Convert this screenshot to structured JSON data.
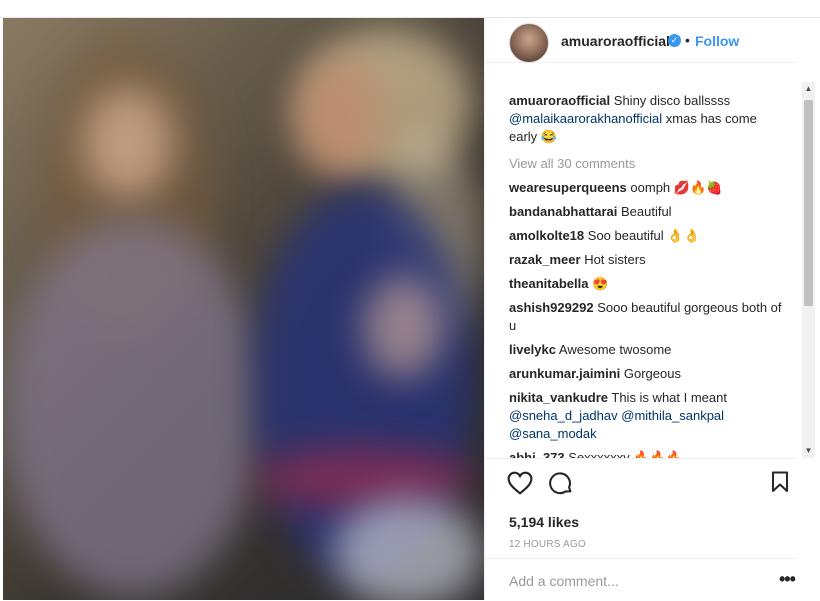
{
  "header": {
    "username": "amuaroraofficial",
    "verified_icon": "verified-check-icon",
    "follow_label": "Follow",
    "separator": "•"
  },
  "caption": {
    "username": "amuaroraofficial",
    "text_before": "Shiny disco ballssss",
    "mention": "@malaikaarorakhanofficial",
    "text_after": "xmas has come early",
    "emoji": "😂"
  },
  "view_all": "View all 30 comments",
  "comments": [
    {
      "user": "wearesuperqueens",
      "text": "oomph",
      "emoji": "💋🔥🍓"
    },
    {
      "user": "bandanabhattarai",
      "text": "Beautiful",
      "emoji": ""
    },
    {
      "user": "amolkolte18",
      "text": "Soo beautiful",
      "emoji": "👌👌"
    },
    {
      "user": "razak_meer",
      "text": "Hot sisters",
      "emoji": ""
    },
    {
      "user": "theanitabella",
      "text": "",
      "emoji": "😍"
    },
    {
      "user": "ashish929292",
      "text": "Sooo beautiful gorgeous both of u",
      "emoji": ""
    },
    {
      "user": "livelykc",
      "text": "Awesome twosome",
      "emoji": ""
    },
    {
      "user": "arunkumar.jaimini",
      "text": "Gorgeous",
      "emoji": ""
    },
    {
      "user": "nikita_vankudre",
      "text": "This is what I meant",
      "mentions": [
        "@sneha_d_jadhav",
        "@mithila_sankpal",
        "@sana_modak"
      ]
    },
    {
      "user": "abhi_373",
      "text": "Sexxxxxxy",
      "emoji": "🔥🔥🔥"
    }
  ],
  "actions": {
    "like_icon": "heart-icon",
    "comment_icon": "comment-icon",
    "save_icon": "bookmark-icon"
  },
  "likes": "5,194 likes",
  "timestamp": "12 HOURS AGO",
  "add_comment_placeholder": "Add a comment...",
  "more_label": "•••"
}
